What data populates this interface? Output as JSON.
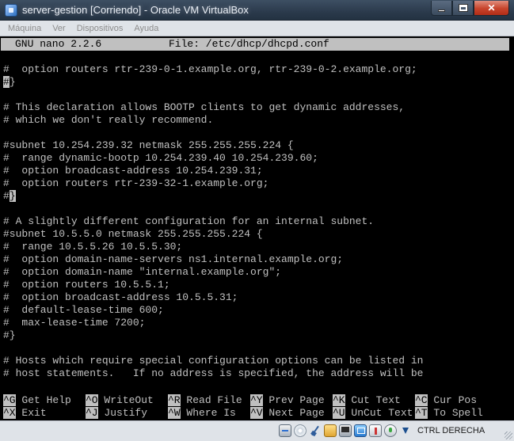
{
  "window": {
    "title": "server-gestion [Corriendo] - Oracle VM VirtualBox"
  },
  "menubar": {
    "items": [
      "Máquina",
      "Ver",
      "Dispositivos",
      "Ayuda"
    ]
  },
  "nano": {
    "version": "GNU nano 2.2.6",
    "file": "File: /etc/dhcp/dhcpd.conf",
    "lines": [
      "#  option routers rtr-239-0-1.example.org, rtr-239-0-2.example.org;",
      "#}",
      "",
      "# This declaration allows BOOTP clients to get dynamic addresses,",
      "# which we don't really recommend.",
      "",
      "#subnet 10.254.239.32 netmask 255.255.255.224 {",
      "#  range dynamic-bootp 10.254.239.40 10.254.239.60;",
      "#  option broadcast-address 10.254.239.31;",
      "#  option routers rtr-239-32-1.example.org;",
      "#}",
      "",
      "# A slightly different configuration for an internal subnet.",
      "#subnet 10.5.5.0 netmask 255.255.255.224 {",
      "#  range 10.5.5.26 10.5.5.30;",
      "#  option domain-name-servers ns1.internal.example.org;",
      "#  option domain-name \"internal.example.org\";",
      "#  option routers 10.5.5.1;",
      "#  option broadcast-address 10.5.5.31;",
      "#  default-lease-time 600;",
      "#  max-lease-time 7200;",
      "#}",
      "",
      "# Hosts which require special configuration options can be listed in",
      "# host statements.   If no address is specified, the address will be"
    ],
    "shortcuts_row1": [
      {
        "key": "^G",
        "label": " Get Help"
      },
      {
        "key": "^O",
        "label": " WriteOut"
      },
      {
        "key": "^R",
        "label": " Read File"
      },
      {
        "key": "^Y",
        "label": " Prev Page"
      },
      {
        "key": "^K",
        "label": " Cut Text"
      },
      {
        "key": "^C",
        "label": " Cur Pos"
      }
    ],
    "shortcuts_row2": [
      {
        "key": "^X",
        "label": " Exit"
      },
      {
        "key": "^J",
        "label": " Justify"
      },
      {
        "key": "^W",
        "label": " Where Is"
      },
      {
        "key": "^V",
        "label": " Next Page"
      },
      {
        "key": "^U",
        "label": " UnCut Text"
      },
      {
        "key": "^T",
        "label": " To Spell"
      }
    ]
  },
  "statusbar": {
    "host_key": "CTRL DERECHA",
    "icons": [
      "hard-disk-icon",
      "optical-drive-icon",
      "usb-icon",
      "shared-folders-icon",
      "network-icon",
      "display-icon",
      "video-capture-icon",
      "mouse-integration-icon",
      "host-key-arrow-icon"
    ]
  },
  "colors": {
    "terminal_bg": "#000000",
    "terminal_fg": "#c0c0c0",
    "header_bg": "#c0c0c0"
  }
}
